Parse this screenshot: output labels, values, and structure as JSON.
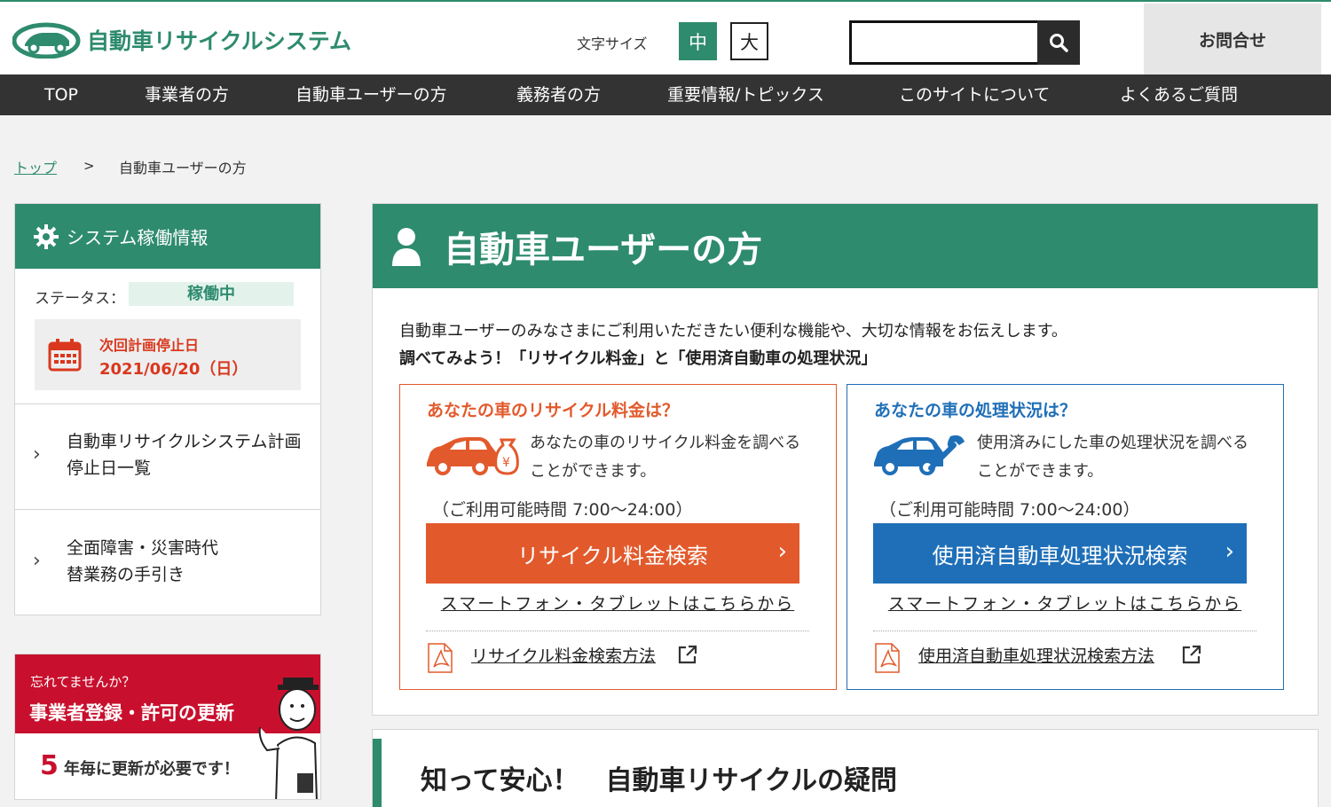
{
  "header": {
    "logo_text": "自動車リサイクルシステム",
    "font_size_label": "文字サイズ",
    "font_size_medium": "中",
    "font_size_large": "大",
    "search_placeholder": "",
    "contact_label": "お問合せ"
  },
  "nav": {
    "items": [
      {
        "label": "TOP"
      },
      {
        "label": "事業者の方"
      },
      {
        "label": "自動車ユーザーの方"
      },
      {
        "label": "義務者の方"
      },
      {
        "label": "重要情報/トピックス"
      },
      {
        "label": "このサイトについて"
      },
      {
        "label": "よくあるご質問"
      }
    ]
  },
  "breadcrumb": {
    "top": "トップ",
    "separator": ">",
    "current": "自動車ユーザーの方"
  },
  "sidebar": {
    "status_heading": "システム稼働情報",
    "status_label": "ステータス：",
    "status_value": "稼働中",
    "next_stop_label": "次回計画停止日",
    "next_stop_date": "2021/06/20（日）",
    "links": [
      {
        "label": "自動車リサイクルシステム計画停止日一覧"
      },
      {
        "label": "全面障害・災害時代替業務の手引き"
      }
    ],
    "banner": {
      "subtitle": "忘れてませんか？",
      "title": "事業者登録・許可の更新",
      "years": "5",
      "bottom_text": "年毎に更新が必要です！"
    }
  },
  "main": {
    "title": "自動車ユーザーの方",
    "intro": "自動車ユーザーのみなさまにご利用いただきたい便利な機能や、大切な情報をお伝えします。",
    "intro_bold": "調べてみよう！「リサイクル料金」と「使用済自動車の処理状況」",
    "cards": [
      {
        "title": "あなたの車のリサイクル料金は？",
        "desc": "あなたの車のリサイクル料金を調べることができます。",
        "hours": "（ご利用可能時間 7:00〜24:00）",
        "button": "リサイクル料金検索",
        "smartphone_link": "スマートフォン・タブレットはこちらから",
        "method_link": "リサイクル料金検索方法",
        "color": "#e25a2c"
      },
      {
        "title": "あなたの車の処理状況は？",
        "desc": "使用済みにした車の処理状況を調べることができます。",
        "hours": "（ご利用可能時間 7:00〜24:00）",
        "button": "使用済自動車処理状況検索",
        "smartphone_link": "スマートフォン・タブレットはこちらから",
        "method_link": "使用済自動車処理状況検索方法",
        "color": "#1f6fb8"
      }
    ],
    "faq_title": "知って安心！　自動車リサイクルの疑問"
  },
  "colors": {
    "brand_green": "#2e8b6e",
    "nav_bg": "#333333",
    "alert_red": "#d9381e",
    "banner_red": "#c8102e"
  }
}
